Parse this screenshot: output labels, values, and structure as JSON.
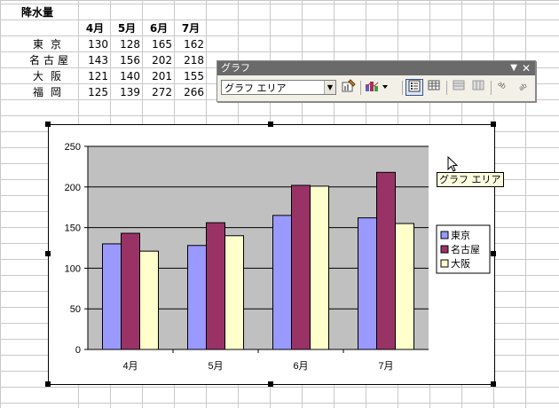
{
  "sheet": {
    "title": "降水量",
    "months": [
      "4月",
      "5月",
      "6月",
      "7月"
    ],
    "rows": [
      {
        "city": "東京",
        "values": [
          "130",
          "128",
          "165",
          "162"
        ]
      },
      {
        "city": "名古屋",
        "values": [
          "143",
          "156",
          "202",
          "218"
        ]
      },
      {
        "city": "大阪",
        "values": [
          "121",
          "140",
          "201",
          "155"
        ]
      },
      {
        "city": "福岡",
        "values": [
          "125",
          "139",
          "272",
          "266"
        ]
      }
    ]
  },
  "toolbar": {
    "title": "グラフ",
    "object_select_value": "グラフ エリア",
    "icons": [
      "format-chart-area-icon",
      "chart-type-icon",
      "legend-icon",
      "data-table-icon",
      "by-row-icon",
      "by-column-icon",
      "angle-text-downward-icon",
      "angle-text-upward-icon"
    ]
  },
  "tooltip": "グラフ エリア",
  "chart_data": {
    "type": "bar",
    "categories": [
      "4月",
      "5月",
      "6月",
      "7月"
    ],
    "series": [
      {
        "name": "東京",
        "values": [
          130,
          128,
          165,
          162
        ],
        "color": "#9999ff"
      },
      {
        "name": "名古屋",
        "values": [
          143,
          156,
          202,
          218
        ],
        "color": "#993366"
      },
      {
        "name": "大阪",
        "values": [
          121,
          140,
          201,
          155
        ],
        "color": "#ffffcc"
      }
    ],
    "ylim": [
      0,
      250
    ],
    "yticks": [
      0,
      50,
      100,
      150,
      200,
      250
    ],
    "grid": true,
    "plot_background": "#c0c0c0",
    "legend_position": "right"
  }
}
